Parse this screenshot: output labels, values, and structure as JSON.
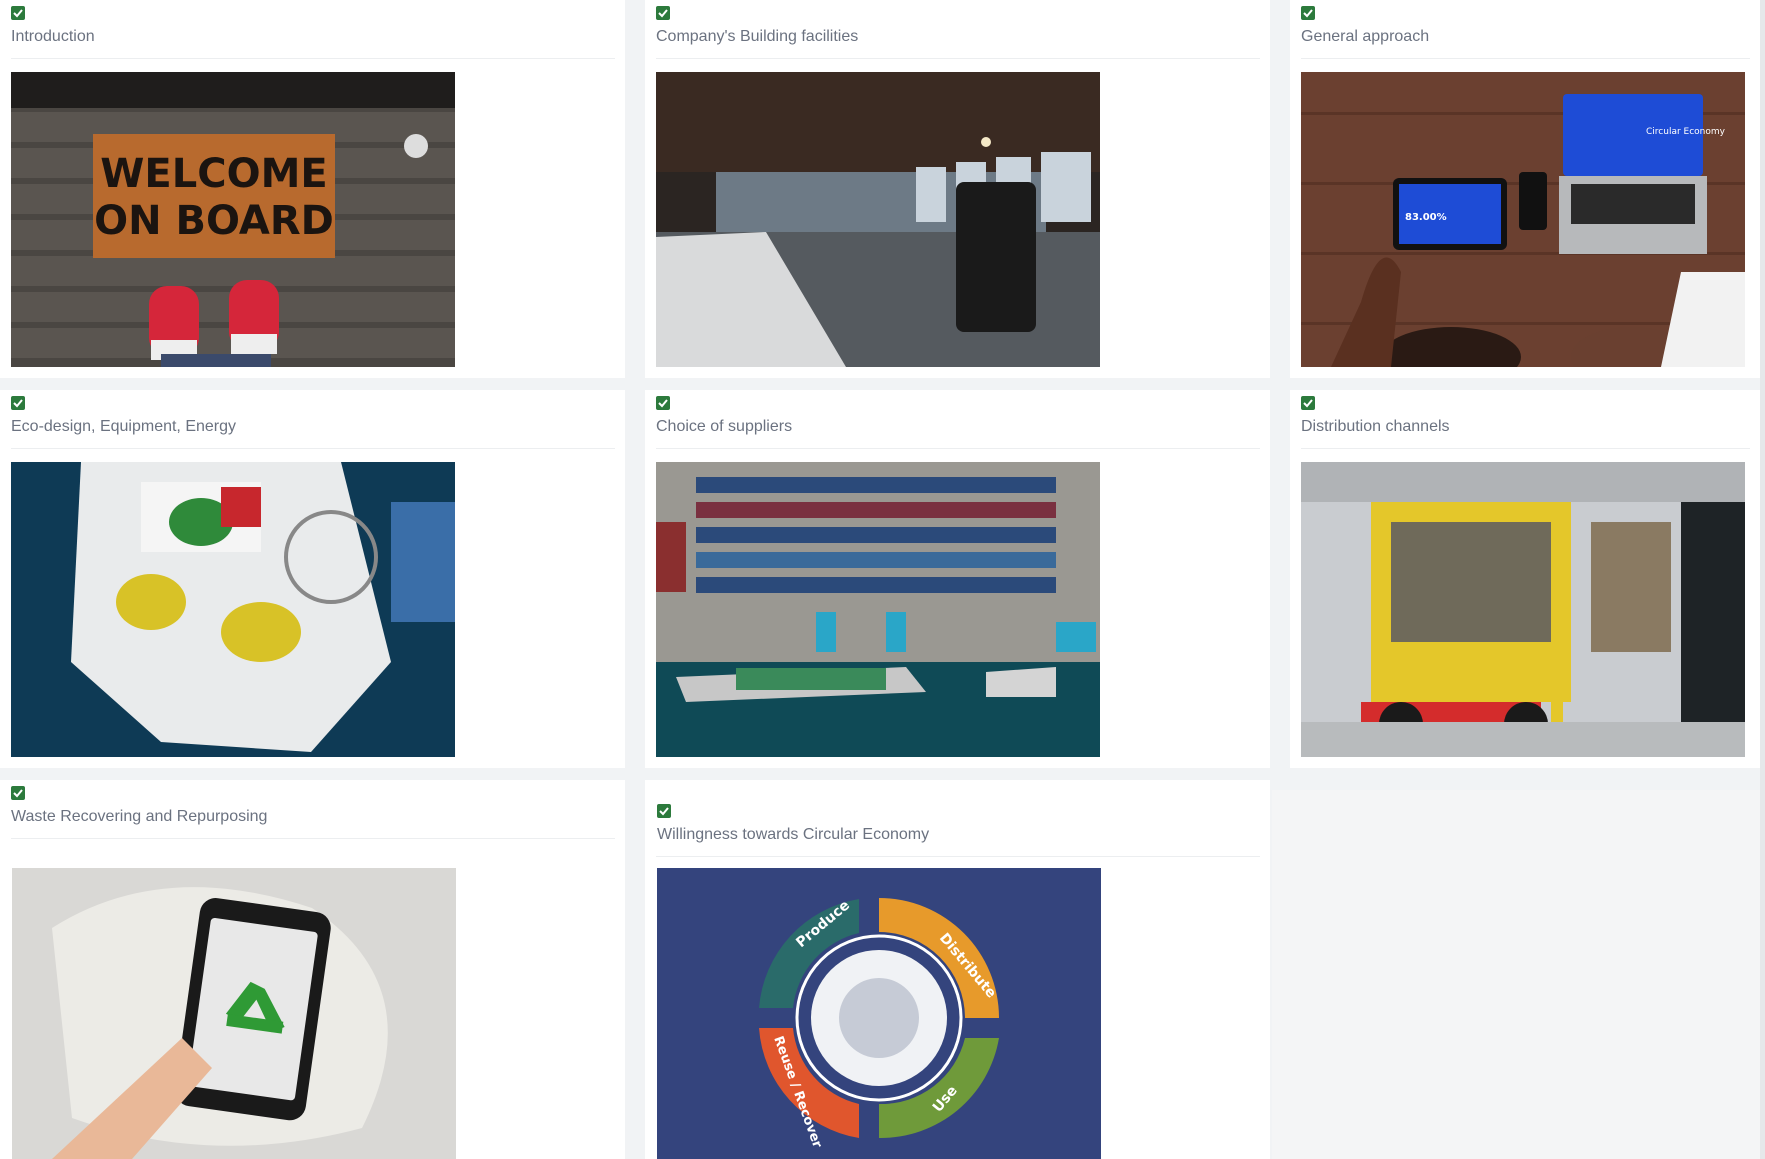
{
  "cards": [
    {
      "title": "Introduction",
      "checked": true,
      "image_alt": "welcome-on-board-doormat",
      "mat_text_1": "WELCOME",
      "mat_text_2": "ON BOARD"
    },
    {
      "title": "Company's Building facilities",
      "checked": true,
      "image_alt": "open-plan-office"
    },
    {
      "title": "General approach",
      "checked": true,
      "image_alt": "laptop-and-tablet-on-desk",
      "laptop_text": "Circular Economy",
      "tablet_text": "83.00%"
    },
    {
      "title": "Eco-design, Equipment, Energy",
      "checked": true,
      "image_alt": "fishing-boat-aerial"
    },
    {
      "title": "Choice of suppliers",
      "checked": true,
      "image_alt": "container-port-aerial"
    },
    {
      "title": "Distribution channels",
      "checked": true,
      "image_alt": "forklift-in-warehouse"
    },
    {
      "title": "Waste Recovering and Repurposing",
      "checked": true,
      "image_alt": "phone-with-recycle-symbol"
    },
    {
      "title": "Willingness towards Circular Economy",
      "checked": true,
      "image_alt": "circular-economy-cycle",
      "cycle_labels": [
        "Produce",
        "Distribute",
        "Use",
        "Reuse / Recover"
      ]
    }
  ],
  "colors": {
    "check_green": "#2c7a3c",
    "title_gray": "#6b7280",
    "card_bg": "#ffffff",
    "page_bg": "#f1f3f5",
    "cycle_bg": "#34447d",
    "cycle_teal": "#2a6b6a",
    "cycle_orange": "#e79a2b",
    "cycle_green": "#6f9a3a",
    "cycle_red": "#e0562d"
  }
}
